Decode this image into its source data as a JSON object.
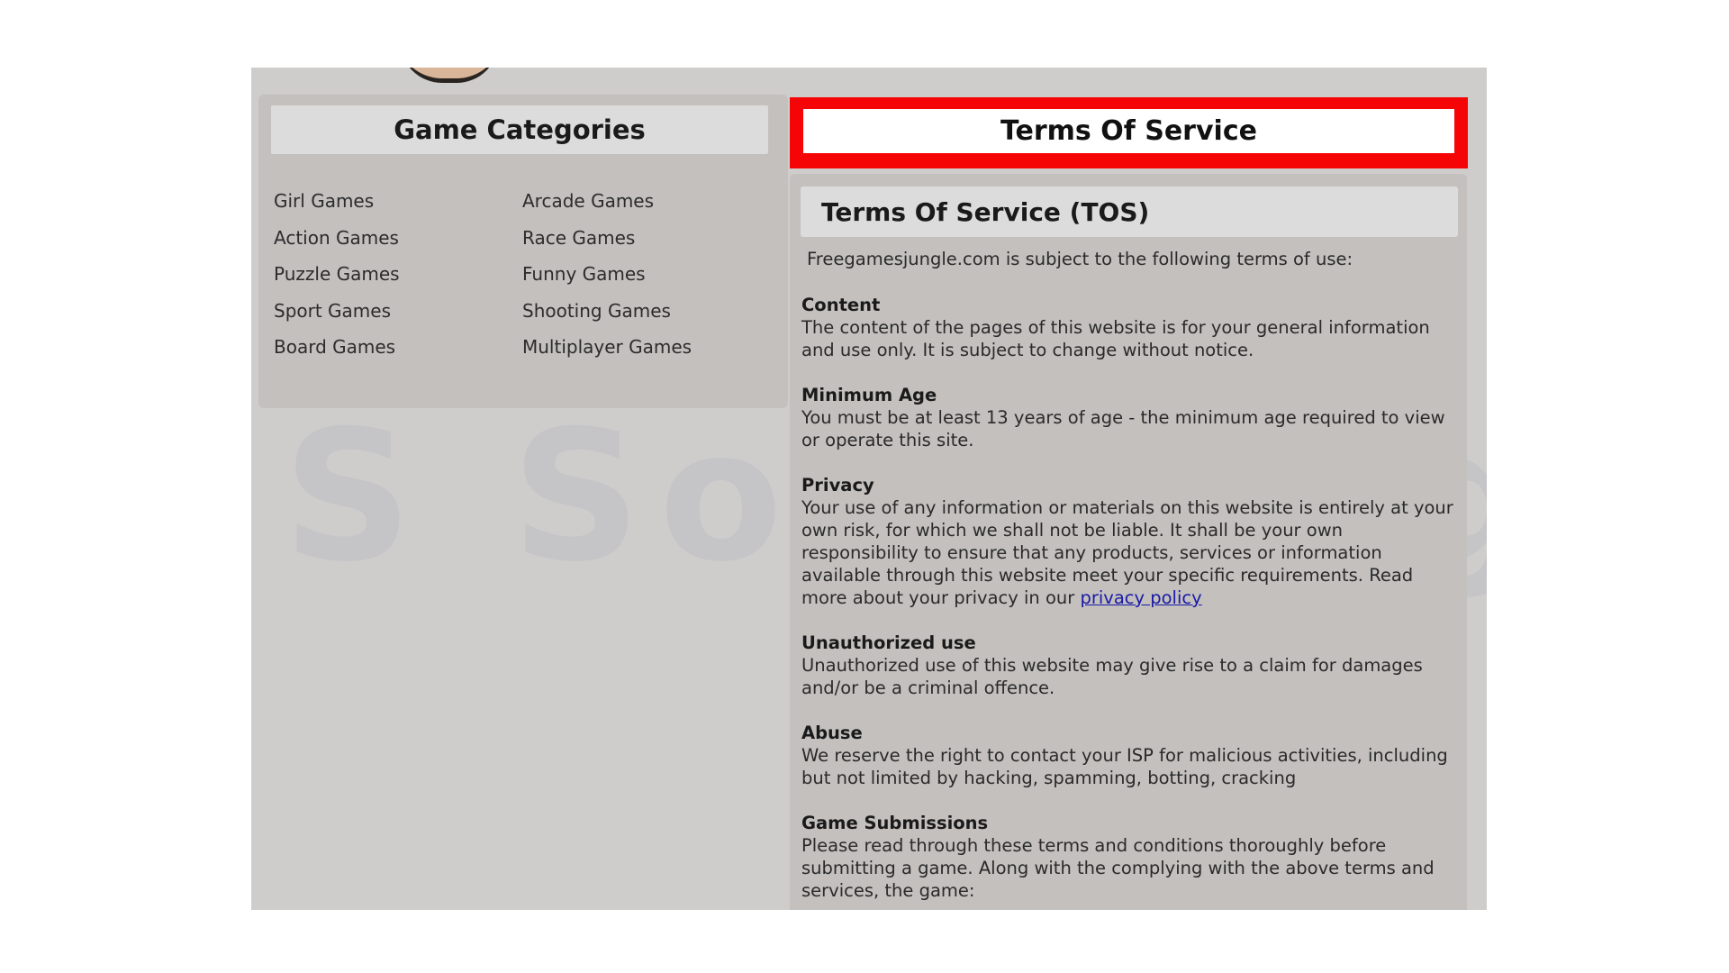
{
  "sidebar": {
    "title": "Game Categories",
    "column_1": [
      "Girl Games",
      "Action Games",
      "Puzzle Games",
      "Sport Games",
      "Board Games"
    ],
    "column_2": [
      "Arcade Games",
      "Race Games",
      "Funny Games",
      "Shooting Games",
      "Multiplayer Games"
    ]
  },
  "banner": {
    "title": "Terms Of Service",
    "highlight_color": "#f50505"
  },
  "tos": {
    "subtitle": "Terms Of Service (TOS)",
    "intro": "Freegamesjungle.com is subject to the following terms of use:",
    "sections": [
      {
        "heading": "Content",
        "text": "The content of the pages of this website is for your general information and use only. It is subject to change without notice."
      },
      {
        "heading": "Minimum Age",
        "text": "You must be at least 13 years of age - the minimum age required to view or operate this site."
      },
      {
        "heading": "Privacy",
        "text": "Your use of any information or materials on this website is entirely at your own risk, for which we shall not be liable. It shall be your own responsibility to ensure that any products, services or information available through this website meet your specific requirements. Read more about your privacy in our",
        "link": "privacy policy"
      },
      {
        "heading": "Unauthorized use",
        "text": "Unauthorized use of this website may give rise to a claim for damages and/or be a criminal offence."
      },
      {
        "heading": "Abuse",
        "text": "We reserve the right to contact your ISP for malicious activities, including but not limited by hacking, spamming, botting, cracking"
      },
      {
        "heading": "Game Submissions",
        "text": "Please read through these terms and conditions thoroughly before submitting a game. Along with the complying with the above terms and services, the game:"
      }
    ]
  },
  "watermark": "S Sourcingor",
  "colors": {
    "page_bg": "#cfcdcc",
    "panel_bg": "#c3c0be",
    "header_bg": "#dcdcdc",
    "link": "#1a1aa6"
  }
}
